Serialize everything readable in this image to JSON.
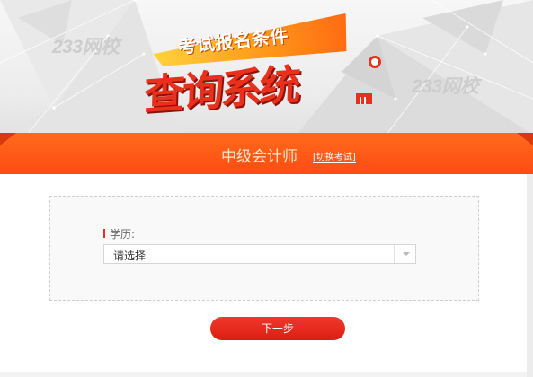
{
  "banner": {
    "watermark_left": "233网校",
    "watermark_right": "233网校",
    "sub_title": "考试报名条件",
    "main_title": "查询系统"
  },
  "exam_bar": {
    "exam_name": "中级会计师",
    "switch_label": "[切换考试]"
  },
  "form": {
    "education": {
      "label": "学历:",
      "selected_value": "请选择",
      "arrow_icon": "chevron-down-icon"
    }
  },
  "actions": {
    "next_label": "下一步"
  },
  "colors": {
    "accent": "#e8301c",
    "bar_orange": "#ff5a16",
    "exam_name_text": "#ffe7ce",
    "button": "#e02416"
  }
}
